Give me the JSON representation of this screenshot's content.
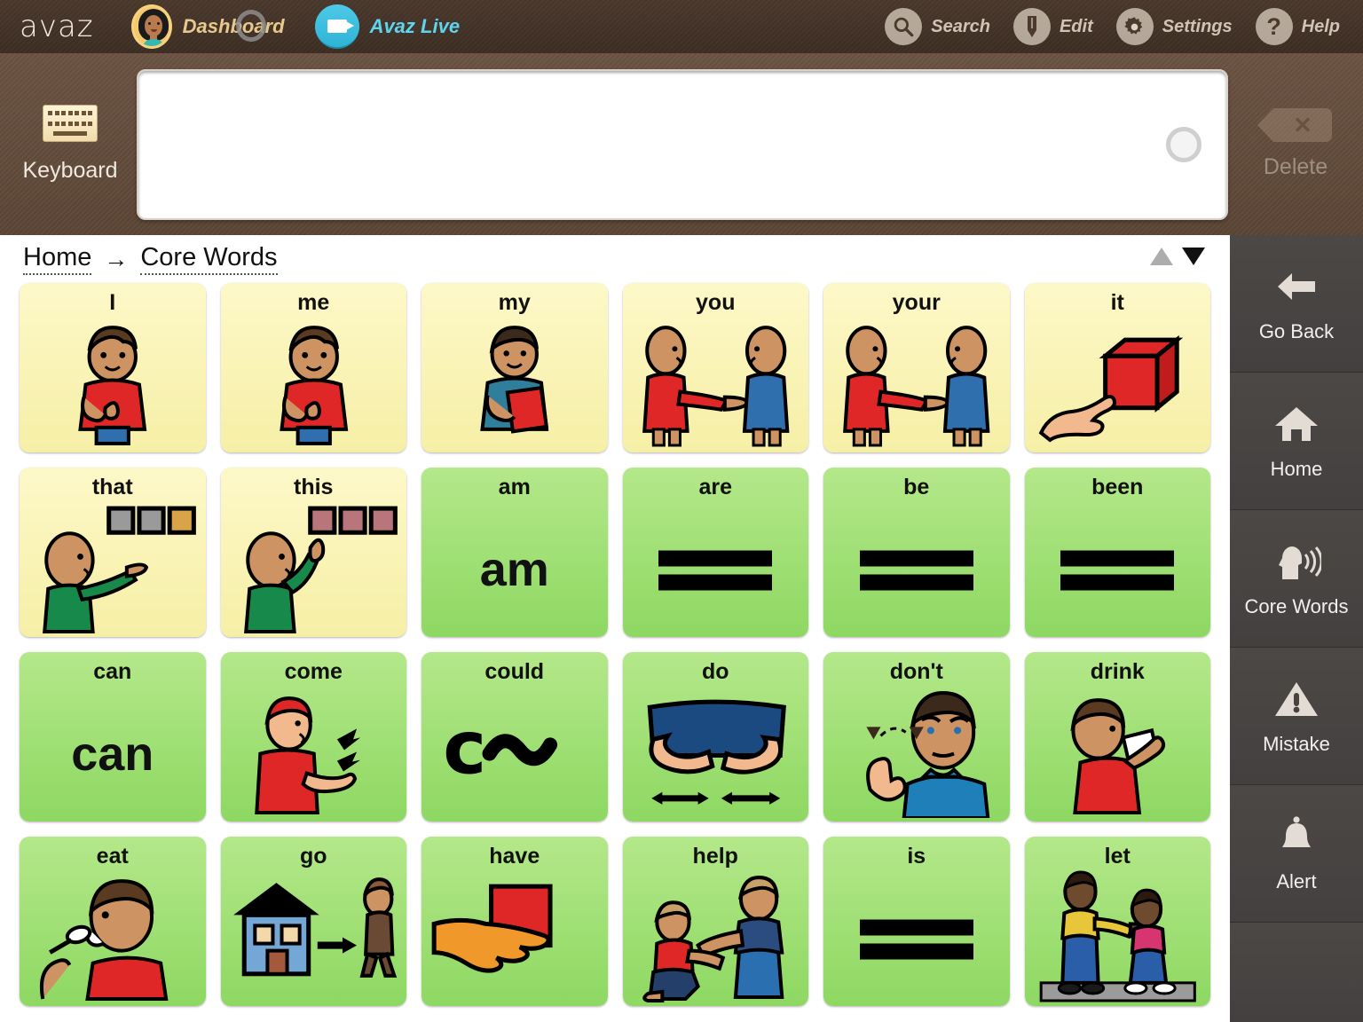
{
  "app": {
    "logo": "avaz",
    "dashboard_label": "Dashboard",
    "live_label": "Avaz Live"
  },
  "toolbar": {
    "items": [
      {
        "label": "Search",
        "icon": "search-icon"
      },
      {
        "label": "Edit",
        "icon": "pencil-icon"
      },
      {
        "label": "Settings",
        "icon": "gear-icon"
      },
      {
        "label": "Help",
        "icon": "question-mark-icon"
      }
    ]
  },
  "message_bar": {
    "keyboard_label": "Keyboard",
    "message_value": "",
    "delete_label": "Delete"
  },
  "breadcrumb": {
    "items": [
      "Home",
      "Core Words"
    ],
    "separator": "→"
  },
  "scroll": {
    "up_enabled": false,
    "down_enabled": true
  },
  "board": {
    "columns": 6,
    "colors": {
      "pronoun": "#f6efa6",
      "verb": "#8ed862"
    },
    "cells": [
      {
        "label": "I",
        "color": "yellow",
        "art": "boy-point-self"
      },
      {
        "label": "me",
        "color": "yellow",
        "art": "boy-point-self"
      },
      {
        "label": "my",
        "color": "yellow",
        "art": "boy-hold-book"
      },
      {
        "label": "you",
        "color": "yellow",
        "art": "two-point"
      },
      {
        "label": "your",
        "color": "yellow",
        "art": "two-point"
      },
      {
        "label": "it",
        "color": "yellow",
        "art": "hand-cube"
      },
      {
        "label": "that",
        "color": "yellow",
        "art": "point-far-squares"
      },
      {
        "label": "this",
        "color": "yellow",
        "art": "point-near-squares"
      },
      {
        "label": "am",
        "color": "green",
        "art": "bigtext",
        "bigtext": "am"
      },
      {
        "label": "are",
        "color": "green",
        "art": "equals"
      },
      {
        "label": "be",
        "color": "green",
        "art": "equals"
      },
      {
        "label": "been",
        "color": "green",
        "art": "equals"
      },
      {
        "label": "can",
        "color": "green",
        "art": "bigtext",
        "bigtext": "can"
      },
      {
        "label": "come",
        "color": "green",
        "art": "boy-beckon"
      },
      {
        "label": "could",
        "color": "green",
        "art": "c-tilde"
      },
      {
        "label": "do",
        "color": "green",
        "art": "hands-arrows"
      },
      {
        "label": "don't",
        "color": "green",
        "art": "man-wag-finger"
      },
      {
        "label": "drink",
        "color": "green",
        "art": "boy-drinking"
      },
      {
        "label": "eat",
        "color": "green",
        "art": "boy-spoon"
      },
      {
        "label": "go",
        "color": "green",
        "art": "house-arrow-walker"
      },
      {
        "label": "have",
        "color": "green",
        "art": "hand-holding-block"
      },
      {
        "label": "help",
        "color": "green",
        "art": "two-people-help"
      },
      {
        "label": "is",
        "color": "green",
        "art": "equals"
      },
      {
        "label": "let",
        "color": "green",
        "art": "man-letting-pass"
      }
    ]
  },
  "sidebar": {
    "items": [
      {
        "label": "Go Back",
        "icon": "arrow-left-icon"
      },
      {
        "label": "Home",
        "icon": "house-icon"
      },
      {
        "label": "Core Words",
        "icon": "speaking-head-icon"
      },
      {
        "label": "Mistake",
        "icon": "warning-triangle-icon"
      },
      {
        "label": "Alert",
        "icon": "bell-icon"
      }
    ]
  }
}
